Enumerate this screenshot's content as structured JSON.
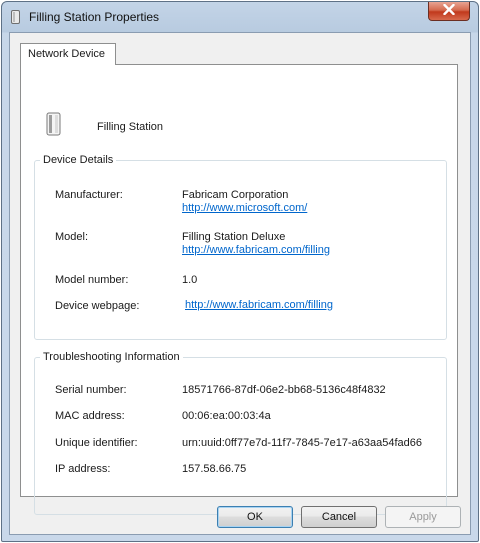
{
  "window": {
    "title": "Filling Station Properties",
    "title_icon": "device-icon",
    "close_icon": "close-icon"
  },
  "tabs": [
    {
      "label": "Network Device",
      "selected": true
    }
  ],
  "device": {
    "icon": "network-device-icon",
    "name": "Filling Station"
  },
  "device_details": {
    "title": "Device Details",
    "manufacturer_label": "Manufacturer:",
    "manufacturer_value": "Fabricam Corporation",
    "manufacturer_link": "http://www.microsoft.com/",
    "model_label": "Model:",
    "model_value": "Filling Station Deluxe",
    "model_link": "http://www.fabricam.com/filling",
    "model_number_label": "Model number:",
    "model_number_value": "1.0",
    "webpage_label": "Device webpage:",
    "webpage_link": "http://www.fabricam.com/filling"
  },
  "troubleshooting": {
    "title": "Troubleshooting Information",
    "serial_label": "Serial number:",
    "serial_value": "18571766-87df-06e2-bb68-5136c48f4832",
    "mac_label": "MAC address:",
    "mac_value": "00:06:ea:00:03:4a",
    "uid_label": "Unique identifier:",
    "uid_value": "urn:uuid:0ff77e7d-11f7-7845-7e17-a63aa54fad66",
    "ip_label": "IP address:",
    "ip_value": "157.58.66.75"
  },
  "buttons": {
    "ok": "OK",
    "cancel": "Cancel",
    "apply": "Apply"
  },
  "colors": {
    "link": "#0066cc",
    "close_button": "#c0391c",
    "frame": "#c3d4e7"
  }
}
